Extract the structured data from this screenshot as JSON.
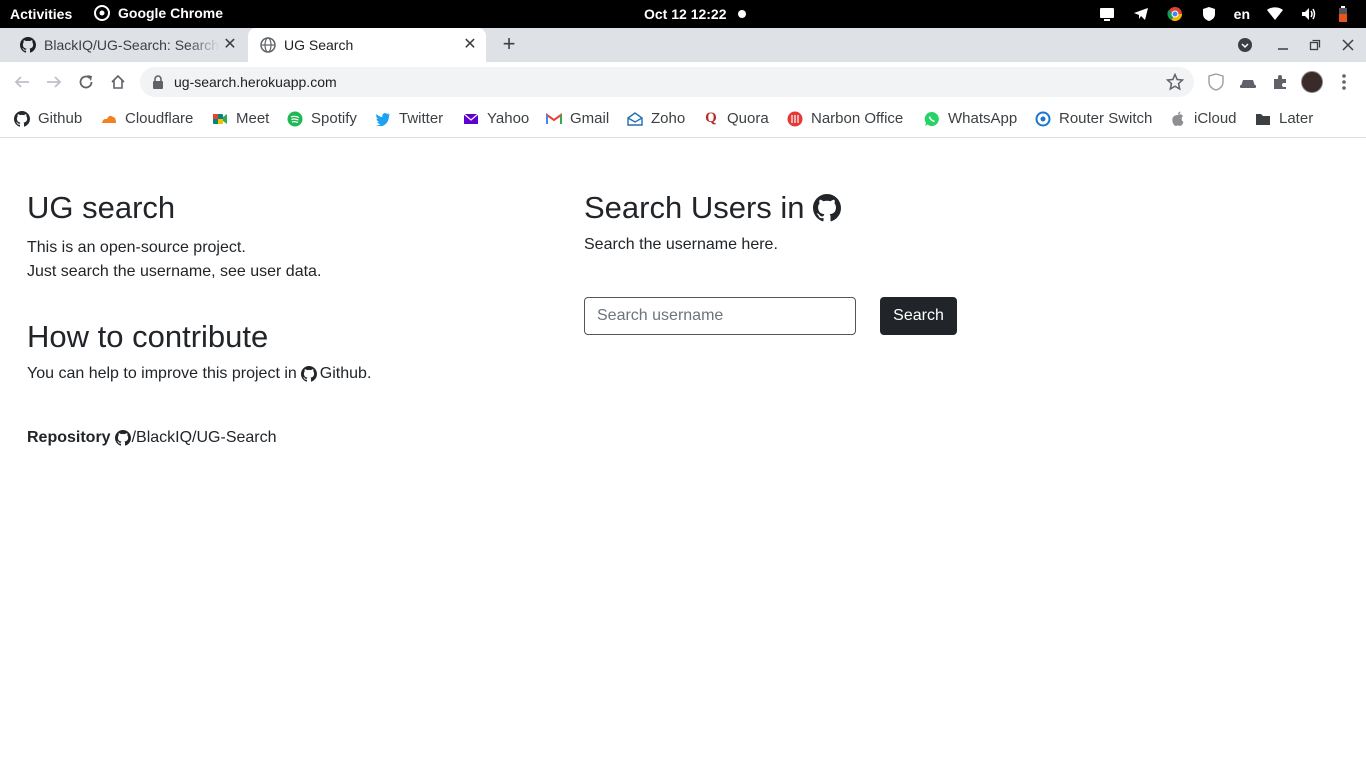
{
  "os_bar": {
    "activities": "Activities",
    "app_name": "Google Chrome",
    "clock": "Oct 12  12:22",
    "language": "en"
  },
  "browser": {
    "tabs": [
      {
        "title": "BlackIQ/UG-Search: Search",
        "icon": "github-icon",
        "active": false
      },
      {
        "title": "UG Search",
        "icon": "globe-icon",
        "active": true
      }
    ],
    "url": "ug-search.herokuapp.com",
    "bookmarks": [
      {
        "label": "Github",
        "icon": "github-icon",
        "color": "#24292e"
      },
      {
        "label": "Cloudflare",
        "icon": "cloudflare-icon",
        "color": "#f48120"
      },
      {
        "label": "Meet",
        "icon": "meet-icon",
        "color": "#00897b"
      },
      {
        "label": "Spotify",
        "icon": "spotify-icon",
        "color": "#1db954"
      },
      {
        "label": "Twitter",
        "icon": "twitter-icon",
        "color": "#1da1f2"
      },
      {
        "label": "Yahoo",
        "icon": "yahoo-icon",
        "color": "#6001d2"
      },
      {
        "label": "Gmail",
        "icon": "gmail-icon",
        "color": "#ea4335"
      },
      {
        "label": "Zoho",
        "icon": "zoho-icon",
        "color": "#226db4"
      },
      {
        "label": "Quora",
        "icon": "quora-icon",
        "color": "#b92b27"
      },
      {
        "label": "Narbon Office",
        "icon": "narbon-icon",
        "color": "#e53935"
      },
      {
        "label": "WhatsApp",
        "icon": "whatsapp-icon",
        "color": "#25d366"
      },
      {
        "label": "Router Switch",
        "icon": "router-icon",
        "color": "#1976d2"
      },
      {
        "label": "iCloud",
        "icon": "apple-icon",
        "color": "#8e8e93"
      },
      {
        "label": "Later",
        "icon": "folder-icon",
        "color": "#3c4043"
      }
    ]
  },
  "page": {
    "left": {
      "title": "UG search",
      "intro_line1": "This is an open-source project.",
      "intro_line2": "Just search the username, see user data.",
      "contribute_title": "How to contribute",
      "contribute_text": "You can help to improve this project in",
      "contribute_link": "Github.",
      "repo_label": "Repository",
      "repo_path": "/BlackIQ/UG-Search"
    },
    "right": {
      "title": "Search Users in",
      "subtitle": "Search the username here.",
      "search_placeholder": "Search username",
      "search_button": "Search"
    }
  },
  "colors": {
    "text": "#212529",
    "button_bg": "#212529",
    "os_bar": "#000000",
    "tabstrip": "#dee1e6"
  }
}
